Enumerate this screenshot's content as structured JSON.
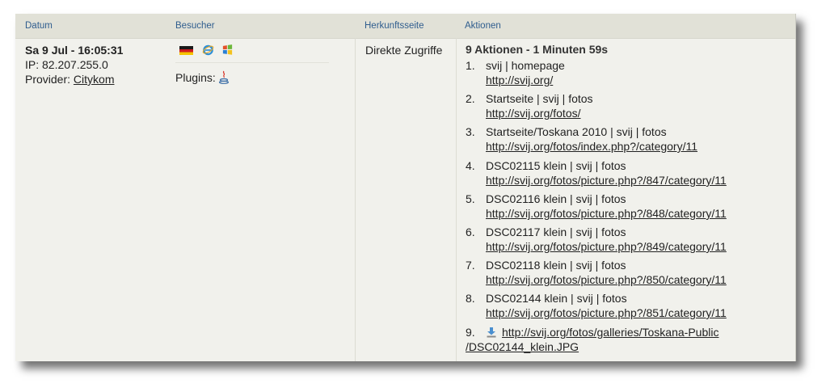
{
  "headers": {
    "datum": "Datum",
    "besucher": "Besucher",
    "herkunft": "Herkunftsseite",
    "aktionen": "Aktionen"
  },
  "visit": {
    "datetime": "Sa 9 Jul - 16:05:31",
    "ip": "IP: 82.207.255.0",
    "provider_label": "Provider: ",
    "provider": "Citykom",
    "plugins_label": "Plugins:",
    "referrer": "Direkte Zugriffe",
    "actions_title": "9 Aktionen - 1 Minuten 59s"
  },
  "icons": {
    "country": "germany-flag-icon",
    "browser": "internet-explorer-icon",
    "os": "windows-icon",
    "plugin": "java-icon",
    "download": "download-icon"
  },
  "actions": [
    {
      "num": "1.",
      "title": "svij | homepage",
      "url": "http://svij.org/"
    },
    {
      "num": "2.",
      "title": "Startseite | svij | fotos",
      "url": "http://svij.org/fotos/"
    },
    {
      "num": "3.",
      "title": "Startseite/Toskana 2010 | svij | fotos",
      "url": "http://svij.org/fotos/index.php?/category/11"
    },
    {
      "num": "4.",
      "title": "DSC02115 klein | svij | fotos",
      "url": "http://svij.org/fotos/picture.php?/847/category/11"
    },
    {
      "num": "5.",
      "title": "DSC02116 klein | svij | fotos",
      "url": "http://svij.org/fotos/picture.php?/848/category/11"
    },
    {
      "num": "6.",
      "title": "DSC02117 klein | svij | fotos",
      "url": "http://svij.org/fotos/picture.php?/849/category/11"
    },
    {
      "num": "7.",
      "title": "DSC02118 klein | svij | fotos",
      "url": "http://svij.org/fotos/picture.php?/850/category/11"
    },
    {
      "num": "8.",
      "title": "DSC02144 klein | svij | fotos",
      "url": "http://svij.org/fotos/picture.php?/851/category/11"
    }
  ],
  "download": {
    "num": "9.",
    "url_line1": "http://svij.org/fotos/galleries/Toskana-Public",
    "url_line2": "/DSC02144_klein.JPG"
  }
}
